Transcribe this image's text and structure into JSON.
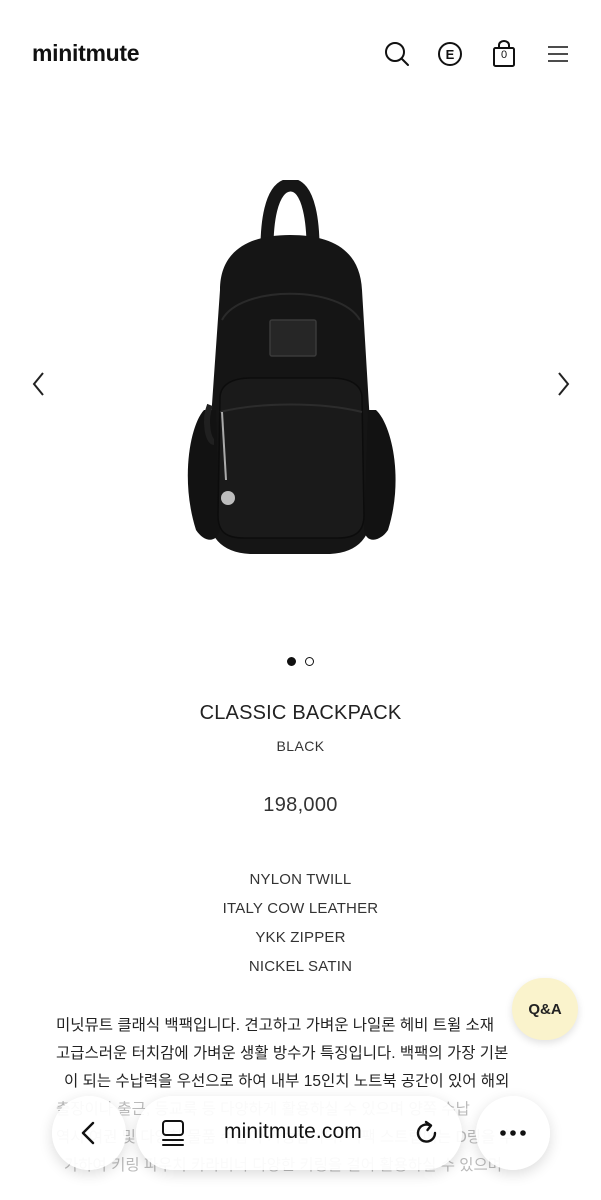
{
  "header": {
    "logo": "minitmute",
    "icons": [
      "search-icon",
      "e-badge-icon",
      "cart-icon",
      "menu-icon"
    ],
    "cart_count": "0"
  },
  "gallery": {
    "image": "black-backpack-product-image",
    "slides_total": 2,
    "active_slide": 1
  },
  "product": {
    "name": "CLASSIC BACKPACK",
    "color": "BLACK",
    "price": "198,000",
    "materials": [
      "NYLON TWILL",
      "ITALY COW LEATHER",
      "YKK ZIPPER",
      "NICKEL SATIN"
    ],
    "description_lines": [
      "미닛뮤트 클래식 백팩입니다. 견고하고 가벼운 나일론 헤비 트윌 소재",
      "고급스러운 터치감에 가벼운 생활 방수가 특징입니다. 백팩의 가장 기본",
      "이 되는 수납력을 우선으로 하여 내부 15인치 노트북 공간이 있어 해외",
      "출장이나 출근, 등교룩 등 다양하게 활용하실 수 있으며 양쪽 수납",
      "역시 여권 및 다양한 물품 수납이 가능합니다. 백팩 스트랩에는 D링을 추",
      "가하여 키링 파우치 카라비너 다양한 키링을 걸어 활용하실 수 있으며"
    ]
  },
  "qa_button": "Q&A",
  "browser": {
    "url": "minitmute.com"
  },
  "colors": {
    "qa_bg": "#faf3cc",
    "text": "#222222"
  }
}
